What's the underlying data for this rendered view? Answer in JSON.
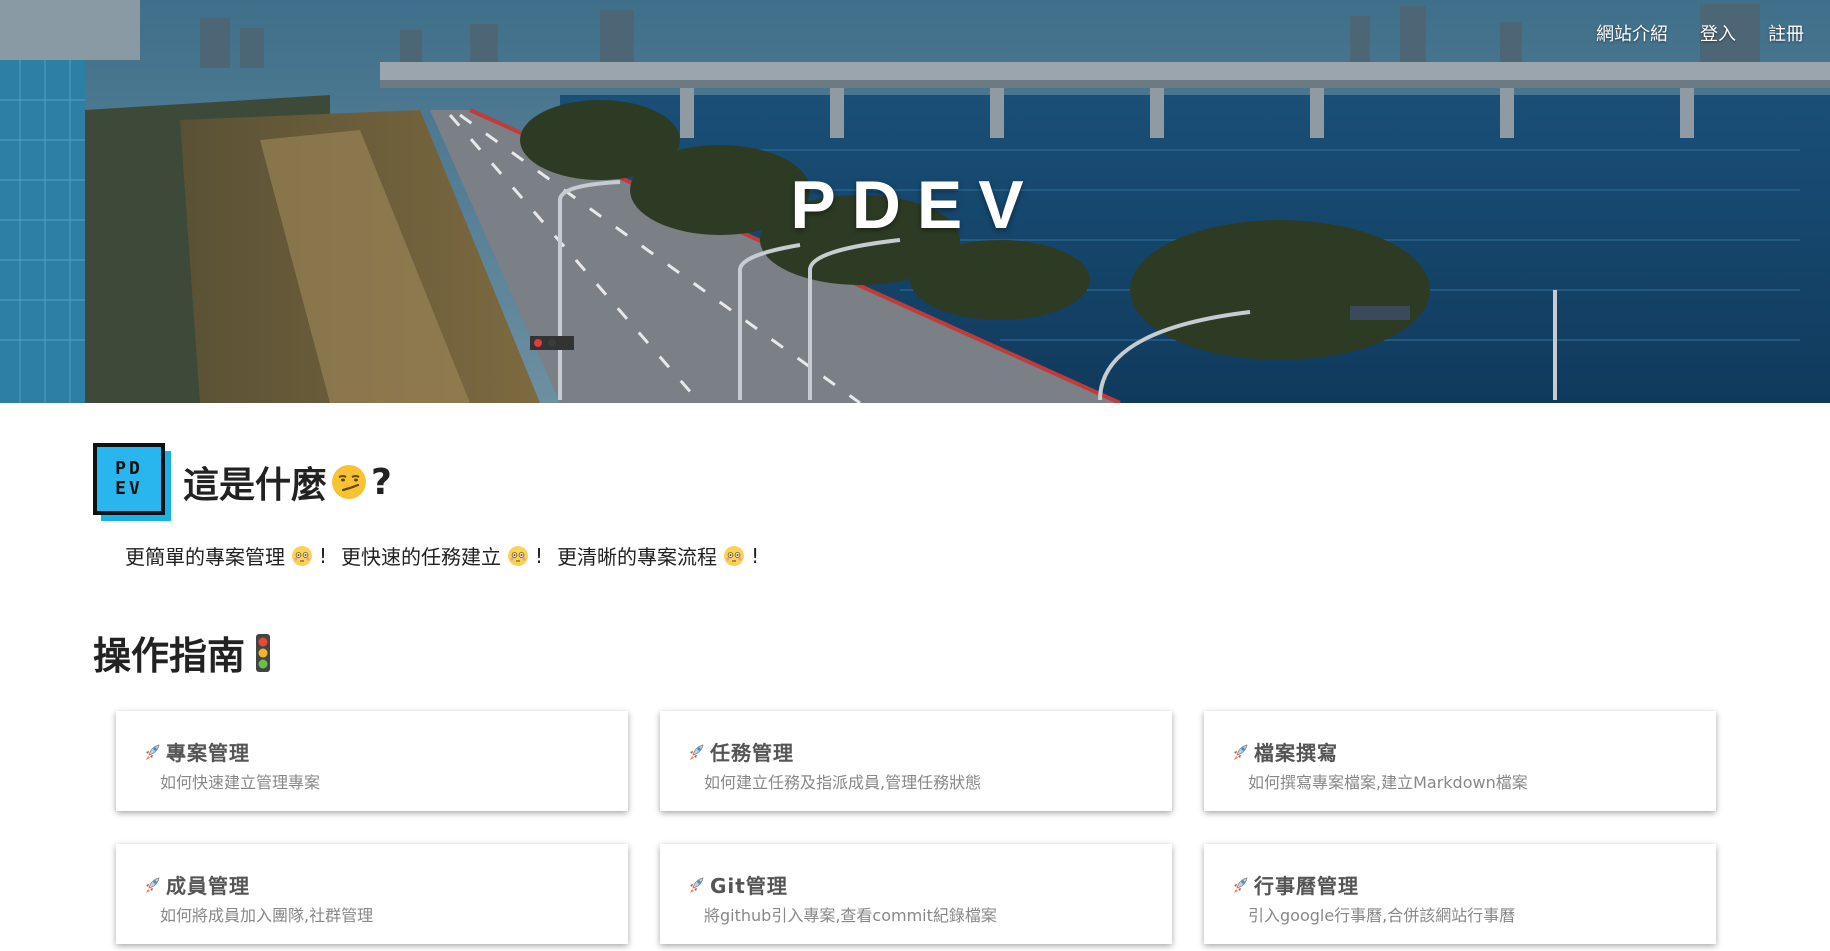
{
  "nav": {
    "items": [
      "網站介紹",
      "登入",
      "註冊"
    ]
  },
  "hero": {
    "title": "PDEV"
  },
  "logo": {
    "line1": "PD",
    "line2": "EV"
  },
  "about": {
    "title": "這是什麼",
    "title_suffix": "?",
    "slogans": [
      "更簡單的專案管理",
      "更快速的任務建立",
      "更清晰的專案流程"
    ],
    "slogan_end": "!"
  },
  "guide": {
    "title": "操作指南"
  },
  "cards": [
    {
      "title": "專案管理",
      "desc": "如何快速建立管理專案"
    },
    {
      "title": "任務管理",
      "desc": "如何建立任務及指派成員,管理任務狀態"
    },
    {
      "title": "檔案撰寫",
      "desc": "如何撰寫專案檔案,建立Markdown檔案"
    },
    {
      "title": "成員管理",
      "desc": "如何將成員加入團隊,社群管理"
    },
    {
      "title": "Git管理",
      "desc": "將github引入專案,查看commit紀錄檔案"
    },
    {
      "title": "行事曆管理",
      "desc": "引入google行事曆,合併該網站行事曆"
    }
  ],
  "icons": {
    "about_emoji": "smirk-face-icon",
    "slogan_emoji": "flushed-face-icon",
    "guide_emoji": "traffic-light-icon",
    "card_emoji": "rocket-icon"
  },
  "colors": {
    "logo_blue": "#29b6ef",
    "card_title": "#555555",
    "card_desc": "#888888"
  }
}
